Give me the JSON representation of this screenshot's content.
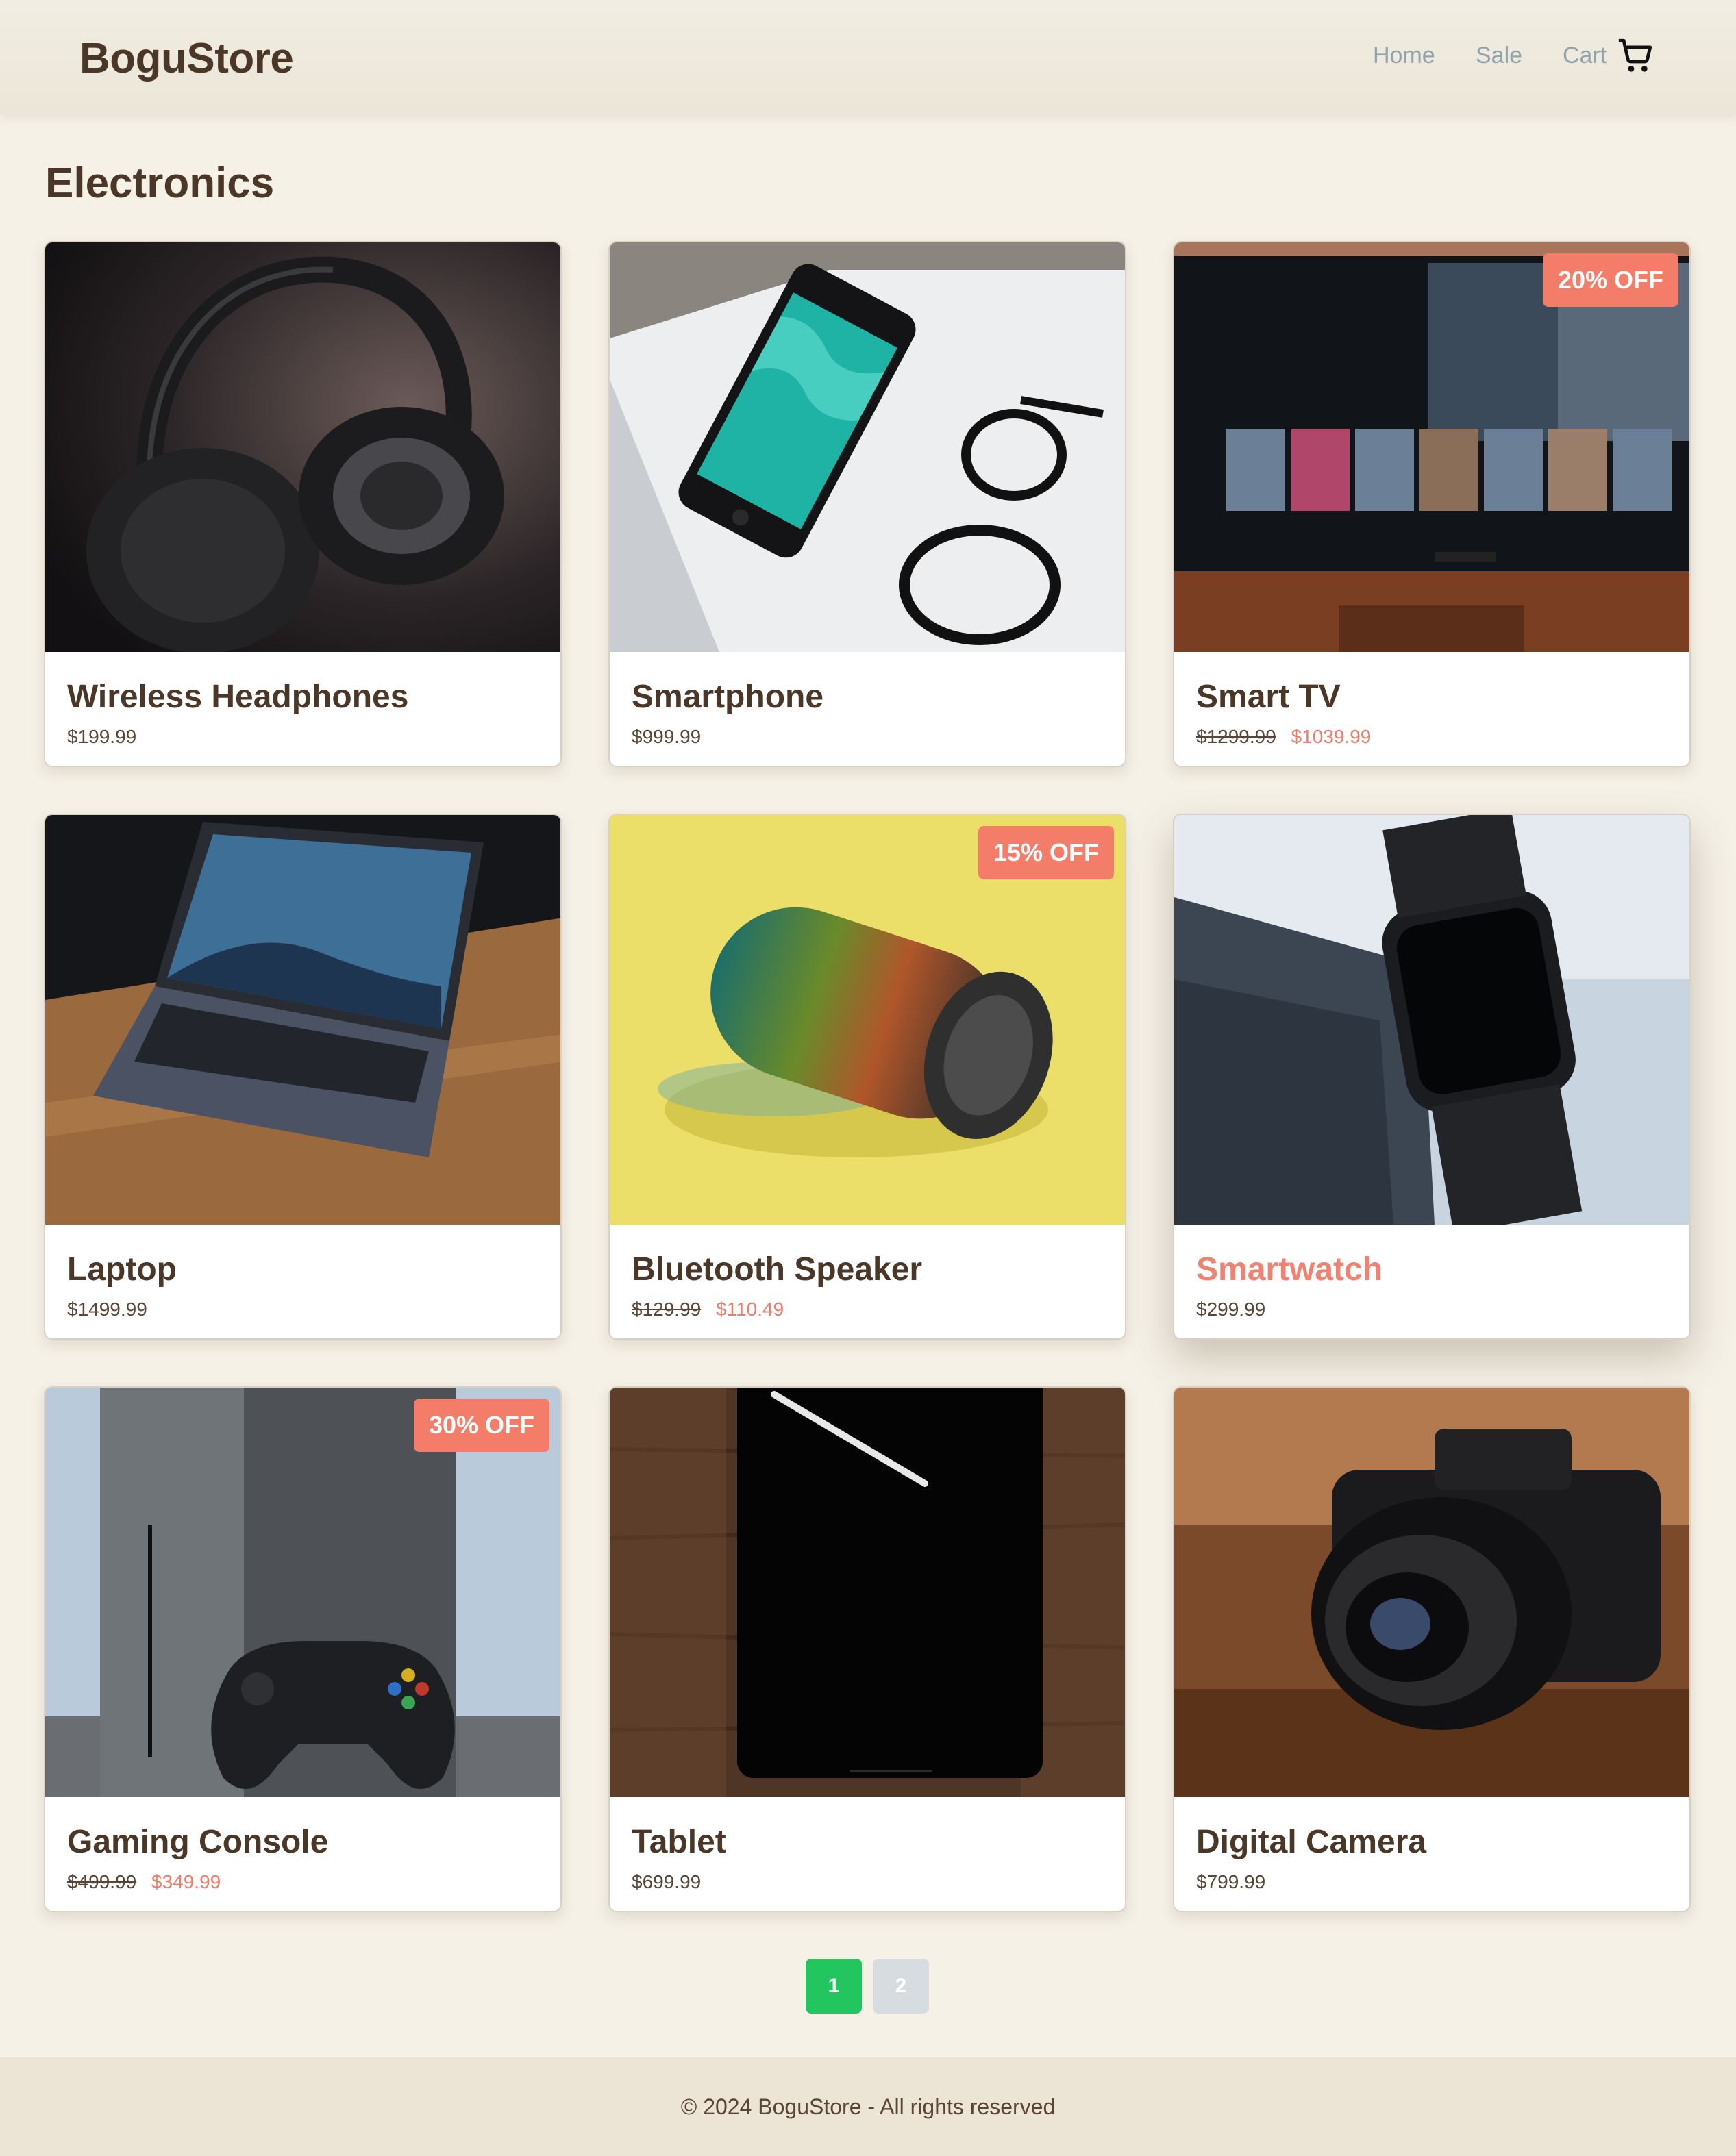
{
  "header": {
    "logo": "BoguStore",
    "nav": {
      "home": "Home",
      "sale": "Sale",
      "cart": "Cart"
    },
    "cart_icon": "shopping-cart-icon"
  },
  "page": {
    "title": "Electronics"
  },
  "products": [
    {
      "name": "Wireless Headphones",
      "price": "$199.99"
    },
    {
      "name": "Smartphone",
      "price": "$999.99"
    },
    {
      "name": "Smart TV",
      "old_price": "$1299.99",
      "sale_price": "$1039.99",
      "badge": "20% OFF"
    },
    {
      "name": "Laptop",
      "price": "$1499.99"
    },
    {
      "name": "Bluetooth Speaker",
      "old_price": "$129.99",
      "sale_price": "$110.49",
      "badge": "15% OFF"
    },
    {
      "name": "Smartwatch",
      "price": "$299.99"
    },
    {
      "name": "Gaming Console",
      "old_price": "$499.99",
      "sale_price": "$349.99",
      "badge": "30% OFF"
    },
    {
      "name": "Tablet",
      "price": "$699.99"
    },
    {
      "name": "Digital Camera",
      "price": "$799.99"
    }
  ],
  "pagination": {
    "pages": [
      "1",
      "2"
    ],
    "current": "1"
  },
  "footer": {
    "text": "© 2024 BoguStore - All rights reserved"
  },
  "colors": {
    "background": "#f5f1e7",
    "accent_sale": "#f47d69",
    "active_page": "#22c55e",
    "text": "#4a3728"
  }
}
